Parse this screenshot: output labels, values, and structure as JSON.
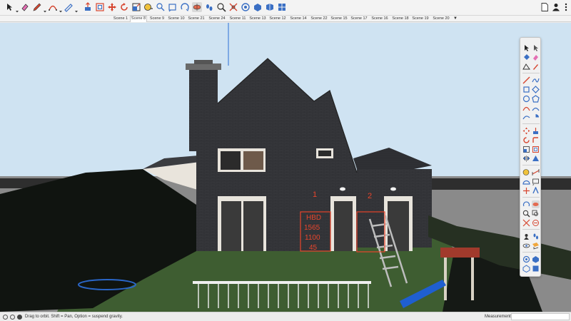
{
  "toolbar": {
    "tools": [
      {
        "name": "select-tool",
        "icon": "arrow-icon"
      },
      {
        "name": "eraser-tool",
        "icon": "eraser-icon"
      },
      {
        "name": "line-tool",
        "icon": "pencil-icon"
      },
      {
        "name": "arc-tool",
        "icon": "arc-icon"
      },
      {
        "name": "rectangle-tool",
        "icon": "rectangle-icon"
      },
      {
        "name": "push-pull-tool",
        "icon": "push-pull-icon"
      },
      {
        "name": "offset-tool",
        "icon": "offset-icon"
      },
      {
        "name": "move-tool",
        "icon": "move-icon"
      },
      {
        "name": "rotate-tool",
        "icon": "rotate-icon"
      },
      {
        "name": "scale-tool",
        "icon": "scale-icon"
      },
      {
        "name": "tape-measure-tool",
        "icon": "tape-measure-icon"
      },
      {
        "name": "text-tool",
        "icon": "text-icon"
      },
      {
        "name": "paint-bucket-tool",
        "icon": "paint-bucket-icon"
      },
      {
        "name": "orbit-tool",
        "icon": "orbit-icon"
      },
      {
        "name": "pan-tool",
        "icon": "pan-icon"
      },
      {
        "name": "zoom-tool",
        "icon": "zoom-icon"
      },
      {
        "name": "zoom-extents-tool",
        "icon": "zoom-extents-icon"
      },
      {
        "name": "warehouse-button",
        "icon": "warehouse-icon"
      },
      {
        "name": "extension-warehouse-button",
        "icon": "extension-warehouse-icon"
      },
      {
        "name": "layout-button",
        "icon": "layout-icon"
      }
    ],
    "right_icons": [
      "document-icon",
      "user-icon",
      "more-options-icon"
    ]
  },
  "scenes": {
    "tabs": [
      "Scene 1",
      "Scene 8",
      "Scene 9",
      "Scene 10",
      "Scene 21",
      "Scene 24",
      "Scene 11",
      "Scene 13",
      "Scene 12",
      "Scene 14",
      "Scene 22",
      "Scene 15",
      "Scene 17",
      "Scene 16",
      "Scene 18",
      "Scene 19",
      "Scene 20"
    ],
    "active_index": 1,
    "more_glyph": "▼"
  },
  "model": {
    "labels": {
      "door1": "1",
      "door2": "2",
      "note_lines": [
        "HBD",
        "1565",
        "1100",
        "45"
      ]
    },
    "colors": {
      "sky": "#cfe3f2",
      "ground": "#8a8a8a",
      "grass": "#3e5d31",
      "brick": "#36373b",
      "roof": "#2f3034",
      "annotation": "#e8452c",
      "axis_blue": "#2d6fd6"
    }
  },
  "palette": {
    "columns": 2,
    "rows": 20
  },
  "statusbar": {
    "hint": "Drag to orbit. Shift = Pan, Option = suspend gravity.",
    "measurements_label": "Measurements",
    "measurements_value": ""
  }
}
